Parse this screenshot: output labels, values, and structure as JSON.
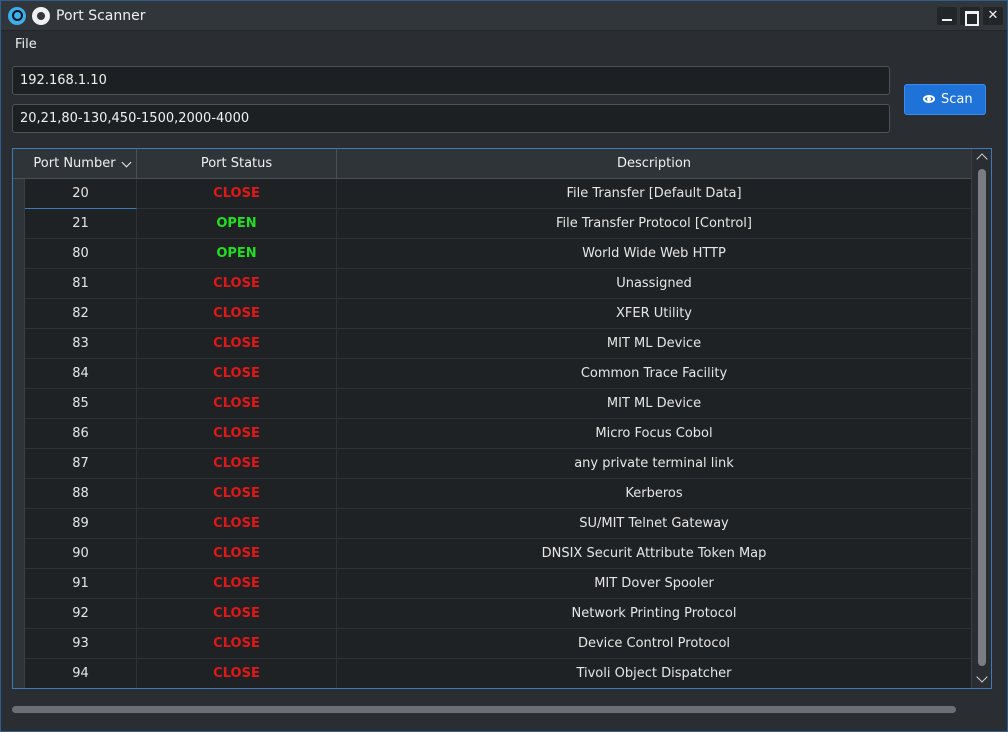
{
  "window": {
    "title": "Port Scanner"
  },
  "menu": {
    "file": "File"
  },
  "inputs": {
    "ip": "192.168.1.10",
    "ports": "20,21,80-130,450-1500,2000-4000"
  },
  "scan_button": {
    "label": "Scan",
    "icon": "eye-icon"
  },
  "table": {
    "headers": [
      "Port Number",
      "Port Status",
      "Description"
    ],
    "sort_column": "Port Number",
    "rows": [
      {
        "port": "20",
        "status": "CLOSE",
        "desc": "File Transfer [Default Data]"
      },
      {
        "port": "21",
        "status": "OPEN",
        "desc": "File Transfer Protocol [Control]"
      },
      {
        "port": "80",
        "status": "OPEN",
        "desc": "World Wide Web HTTP"
      },
      {
        "port": "81",
        "status": "CLOSE",
        "desc": "Unassigned"
      },
      {
        "port": "82",
        "status": "CLOSE",
        "desc": "XFER Utility"
      },
      {
        "port": "83",
        "status": "CLOSE",
        "desc": "MIT ML Device"
      },
      {
        "port": "84",
        "status": "CLOSE",
        "desc": "Common Trace Facility"
      },
      {
        "port": "85",
        "status": "CLOSE",
        "desc": "MIT ML Device"
      },
      {
        "port": "86",
        "status": "CLOSE",
        "desc": "Micro Focus Cobol"
      },
      {
        "port": "87",
        "status": "CLOSE",
        "desc": "any private terminal link"
      },
      {
        "port": "88",
        "status": "CLOSE",
        "desc": "Kerberos"
      },
      {
        "port": "89",
        "status": "CLOSE",
        "desc": "SU/MIT Telnet Gateway"
      },
      {
        "port": "90",
        "status": "CLOSE",
        "desc": "DNSIX Securit Attribute Token Map"
      },
      {
        "port": "91",
        "status": "CLOSE",
        "desc": "MIT Dover Spooler"
      },
      {
        "port": "92",
        "status": "CLOSE",
        "desc": "Network Printing Protocol"
      },
      {
        "port": "93",
        "status": "CLOSE",
        "desc": "Device Control Protocol"
      },
      {
        "port": "94",
        "status": "CLOSE",
        "desc": "Tivoli Object Dispatcher"
      }
    ]
  },
  "colors": {
    "open": "#22dd22",
    "close": "#e01818",
    "accent": "#1e72d8"
  }
}
